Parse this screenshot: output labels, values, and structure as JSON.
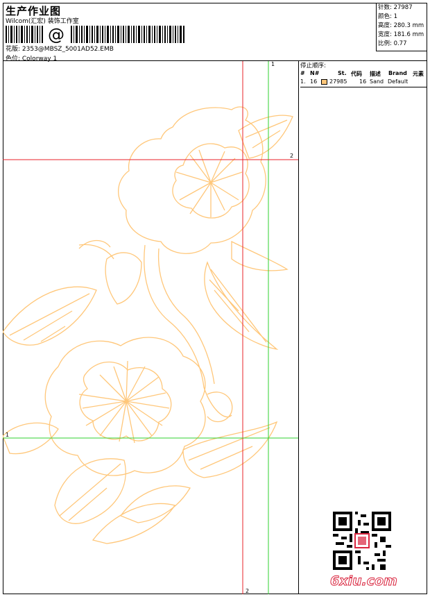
{
  "header": {
    "title": "生产作业图",
    "studio": "Wilcom(汇宏) 装饰工作室",
    "barcode_text": "@",
    "pattern": "花版: 2353@MBSZ_5001AD52.EMB",
    "colorway": "色位: Colorway 1"
  },
  "stats": {
    "stitches": "针数: 27987",
    "colors": "颜色: 1",
    "height": "高度: 280.3 mm",
    "width": "宽度: 181.6 mm",
    "scale": "比例: 0.77"
  },
  "stop_sequence": {
    "title": "停止顺序:",
    "headers": [
      "#",
      "N#",
      "St.",
      "代码",
      "描述",
      "Brand",
      "元素"
    ],
    "rows": [
      {
        "num": "1.",
        "n": "16",
        "stitches": "27985",
        "code": "16",
        "desc": "Sand",
        "brand": "Default",
        "swatch": "#ffc77a"
      }
    ]
  },
  "guides": {
    "v_red_top": "1",
    "v_green_top": "1",
    "h_red_right": "2",
    "h_green_left": "1",
    "v_red_bottom": "2"
  },
  "colors": {
    "thread": "#ffc77a",
    "guide_red": "#e8202a",
    "guide_green": "#2fd12f"
  },
  "watermark": {
    "logo_main": "6xiu",
    "logo_tail": ".com"
  }
}
